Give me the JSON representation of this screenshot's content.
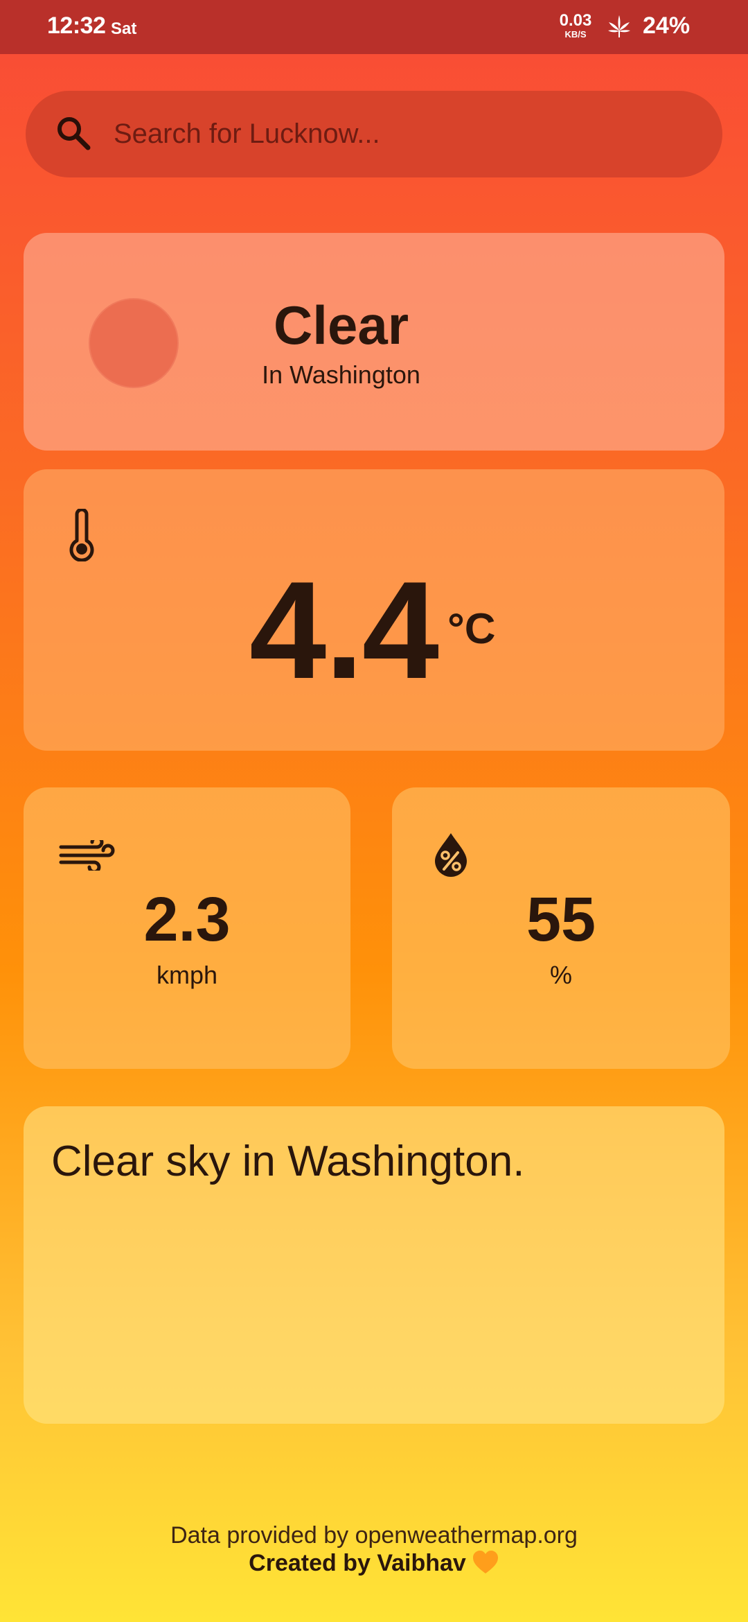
{
  "status_bar": {
    "time": "12:32",
    "day": "Sat",
    "net_speed_value": "0.03",
    "net_speed_unit": "KB/S",
    "battery": "24%",
    "icons": [
      "leaf-icon"
    ]
  },
  "search": {
    "placeholder": "Search for Lucknow...",
    "icon": "search-icon"
  },
  "condition": {
    "title": "Clear",
    "location": "In Washington",
    "icon": "sun-icon"
  },
  "temperature": {
    "value": "4.4",
    "unit": "°C",
    "icon": "thermometer-icon"
  },
  "wind": {
    "value": "2.3",
    "unit": "kmph",
    "icon": "wind-icon"
  },
  "humidity": {
    "value": "55",
    "unit": "%",
    "icon": "humidity-percent-icon"
  },
  "description": {
    "text": "Clear sky in Washington."
  },
  "footer": {
    "credit": "Data provided by openweathermap.org",
    "author": "Created by Vaibhav",
    "icon": "orange-heart-icon"
  },
  "colors": {
    "status_bar": "#b9302a",
    "gradient_top": "#f94a37",
    "gradient_bottom": "#ffe436",
    "search_bar": "#d8432b",
    "text_dark": "#2a160c",
    "heart": "#ff9e1b"
  }
}
